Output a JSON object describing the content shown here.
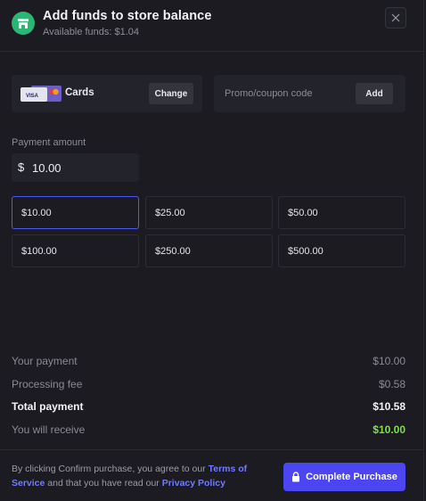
{
  "header": {
    "title": "Add funds to store balance",
    "available_label": "Available funds: $1.04",
    "store_icon": "storefront-icon",
    "close_icon": "close-icon"
  },
  "payment_method": {
    "label": "Cards",
    "card_brands": [
      "VISA",
      "Mastercard"
    ],
    "change_label": "Change"
  },
  "promo": {
    "placeholder": "Promo/coupon code",
    "value": "",
    "add_label": "Add"
  },
  "amount": {
    "label": "Payment amount",
    "currency_symbol": "$",
    "value": "10.00"
  },
  "presets": [
    {
      "label": "$10.00",
      "selected": true
    },
    {
      "label": "$25.00",
      "selected": false
    },
    {
      "label": "$50.00",
      "selected": false
    },
    {
      "label": "$100.00",
      "selected": false
    },
    {
      "label": "$250.00",
      "selected": false
    },
    {
      "label": "$500.00",
      "selected": false
    }
  ],
  "summary": {
    "your_payment": {
      "label": "Your payment",
      "value": "$10.00"
    },
    "processing_fee": {
      "label": "Processing fee",
      "value": "$0.58"
    },
    "total_payment": {
      "label": "Total payment",
      "value": "$10.58"
    },
    "you_will_receive": {
      "label": "You will receive",
      "value": "$10.00"
    }
  },
  "footer": {
    "terms_prefix": "By clicking Confirm purchase, you agree to our ",
    "terms_link": "Terms of Service",
    "terms_middle": " and that you have read our ",
    "privacy_link": "Privacy Policy",
    "complete_label": "Complete Purchase",
    "lock_icon": "lock-icon"
  },
  "colors": {
    "accent": "#4b46f2",
    "link": "#6f7cff",
    "success": "#7ee04a",
    "store_icon_bg": "#2bb673"
  }
}
